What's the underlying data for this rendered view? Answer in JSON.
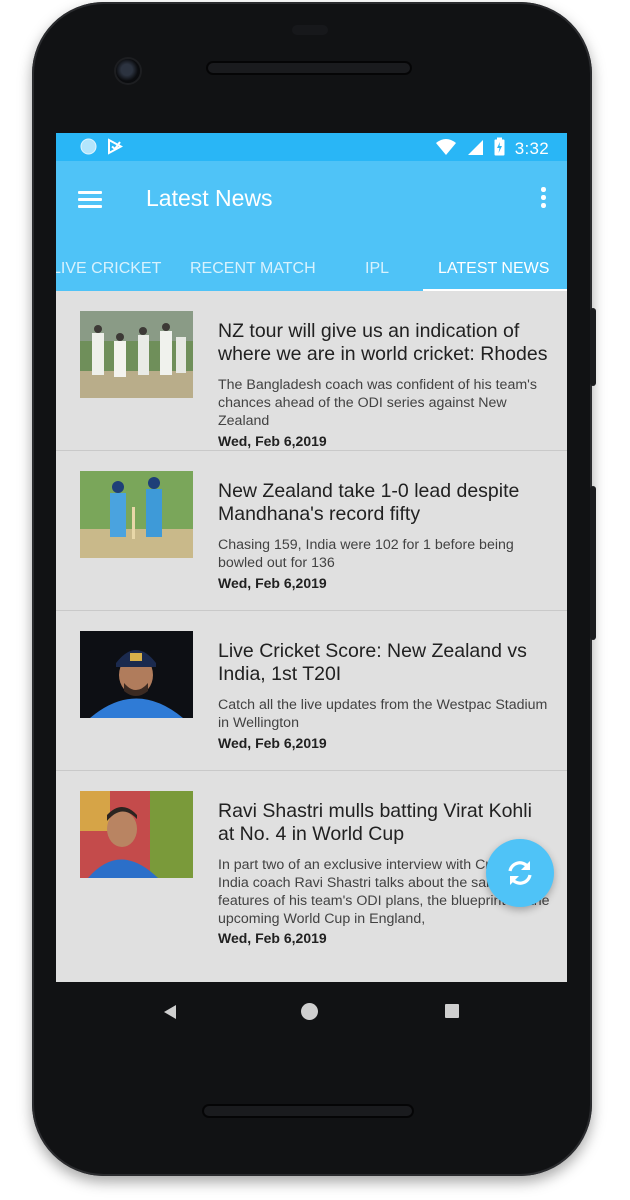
{
  "status_bar": {
    "time": "3:32",
    "left_icons": [
      "circle-notification-icon",
      "play-store-icon"
    ],
    "right_icons": [
      "wifi-icon",
      "signal-icon",
      "battery-charging-icon"
    ]
  },
  "app_bar": {
    "title": "Latest News",
    "menu_icon": "hamburger-menu-icon",
    "overflow_icon": "more-vert-icon"
  },
  "tabs": [
    {
      "label": "LIVE CRICKET",
      "active": false
    },
    {
      "label": "RECENT MATCH",
      "active": false
    },
    {
      "label": "IPL",
      "active": false
    },
    {
      "label": "LATEST NEWS",
      "active": true
    }
  ],
  "news": [
    {
      "title": "NZ tour will give us an indication of where we are in world cricket: Rhodes",
      "description": "The Bangladesh coach was confident of his team's chances ahead of the ODI series against New Zealand",
      "date": "Wed, Feb 6,2019"
    },
    {
      "title": "New Zealand take 1-0 lead despite Mandhana's record fifty",
      "description": "Chasing 159, India were 102 for 1 before being bowled out for 136",
      "date": "Wed, Feb 6,2019"
    },
    {
      "title": "Live Cricket Score: New Zealand vs India, 1st T20I",
      "description": "Catch all the live updates from the Westpac Stadium in Wellington",
      "date": "Wed, Feb 6,2019"
    },
    {
      "title": "Ravi Shastri mulls batting Virat Kohli at No. 4 in World Cup",
      "description": "In part two of an exclusive interview with Cricbuzz, India coach Ravi Shastri talks about the salient features of his team's ODI plans, the blueprint for the upcoming World Cup in England,",
      "date": "Wed, Feb 6,2019"
    }
  ],
  "fab": {
    "icon": "refresh-icon"
  },
  "nav_bar": {
    "icons": [
      "back-icon",
      "home-icon",
      "recents-icon"
    ]
  },
  "colors": {
    "status_bar": "#29b6f6",
    "app_bar": "#4fc3f7",
    "list_background": "#e0e0e0"
  }
}
